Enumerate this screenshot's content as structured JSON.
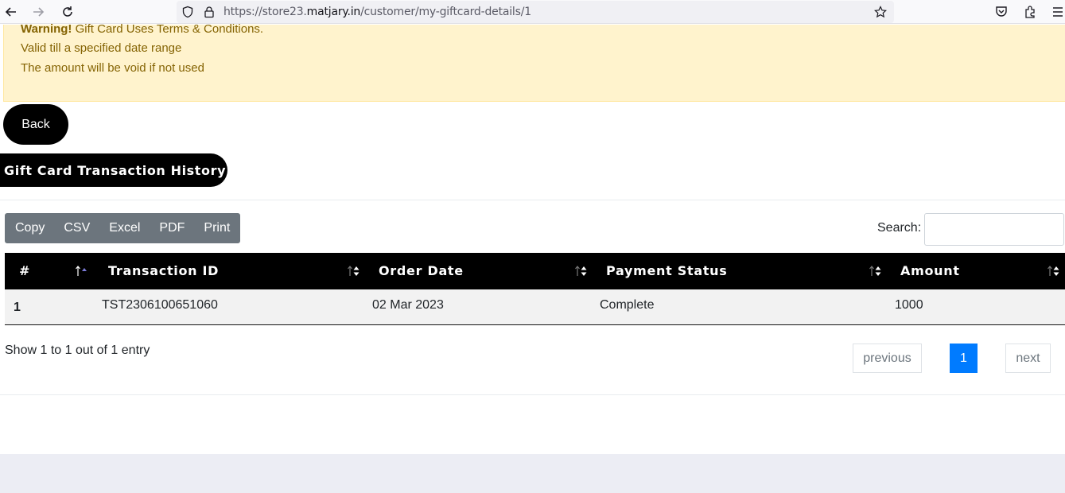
{
  "browser": {
    "url_prefix": "https://store23.",
    "url_host": "matjary.in",
    "url_path": "/customer/my-giftcard-details/1"
  },
  "warning": {
    "title": "Warning!",
    "text": "Gift Card Uses Terms & Conditions.",
    "line2": "Valid till a specified date range",
    "line3": "The amount will be void if not used"
  },
  "buttons": {
    "back": "Back",
    "history": "Gift Card Transaction History"
  },
  "exports": [
    "Copy",
    "CSV",
    "Excel",
    "PDF",
    "Print"
  ],
  "search": {
    "label": "Search:",
    "value": "",
    "placeholder": ""
  },
  "table": {
    "headers": [
      "#",
      "Transaction ID",
      "Order Date",
      "Payment Status",
      "Amount"
    ],
    "rows": [
      [
        "1",
        "TST2306100651060",
        "02 Mar 2023",
        "Complete",
        "1000"
      ]
    ]
  },
  "info": "Show 1 to 1 out of 1 entry",
  "pagination": {
    "previous": "previous",
    "current": "1",
    "next": "next"
  },
  "colors": {
    "warning_bg": "#fff3cd",
    "warning_text": "#856404",
    "active_page": "#007bff",
    "export_bg": "#6c757d"
  }
}
